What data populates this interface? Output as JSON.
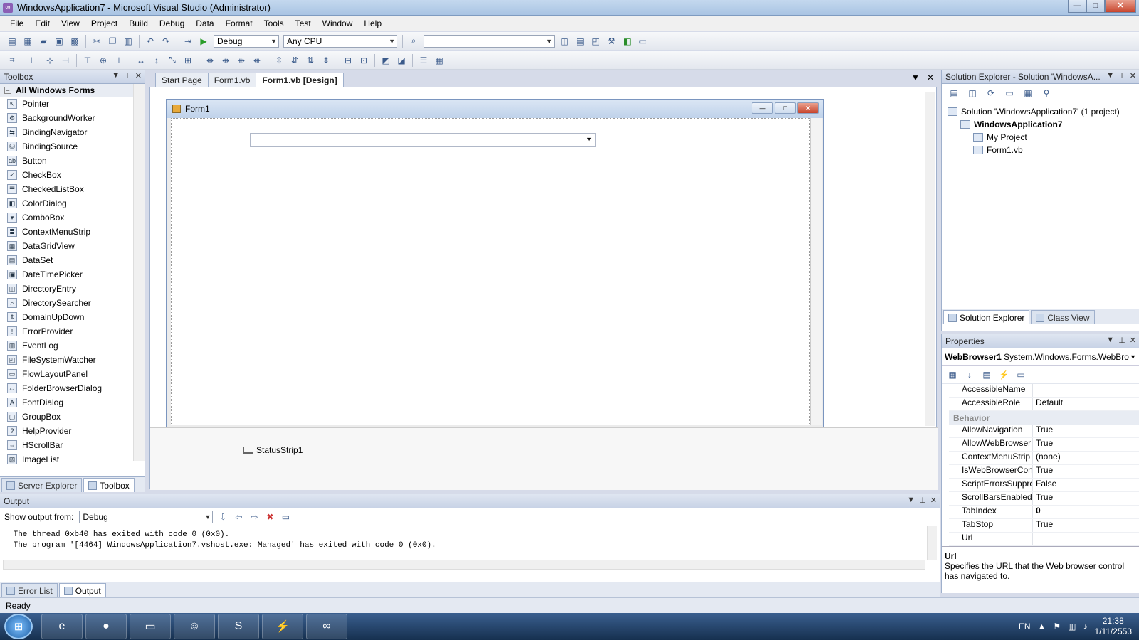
{
  "window": {
    "title": "WindowsApplication7 - Microsoft Visual Studio (Administrator)",
    "minimize": "—",
    "maximize": "□",
    "close": "✕"
  },
  "menu": [
    "File",
    "Edit",
    "View",
    "Project",
    "Build",
    "Debug",
    "Data",
    "Format",
    "Tools",
    "Test",
    "Window",
    "Help"
  ],
  "toolbar": {
    "config": "Debug",
    "platform": "Any CPU",
    "find": ""
  },
  "toolbox": {
    "title": "Toolbox",
    "group": "All Windows Forms",
    "items": [
      {
        "label": "Pointer",
        "icon": "pointer-icon",
        "glyph": "↖"
      },
      {
        "label": "BackgroundWorker",
        "icon": "background-worker-icon",
        "glyph": "⚙"
      },
      {
        "label": "BindingNavigator",
        "icon": "binding-navigator-icon",
        "glyph": "⇆"
      },
      {
        "label": "BindingSource",
        "icon": "binding-source-icon",
        "glyph": "⛁"
      },
      {
        "label": "Button",
        "icon": "button-icon",
        "glyph": "ab"
      },
      {
        "label": "CheckBox",
        "icon": "checkbox-icon",
        "glyph": "✓"
      },
      {
        "label": "CheckedListBox",
        "icon": "checked-listbox-icon",
        "glyph": "☰"
      },
      {
        "label": "ColorDialog",
        "icon": "color-dialog-icon",
        "glyph": "◧"
      },
      {
        "label": "ComboBox",
        "icon": "combobox-icon",
        "glyph": "▾"
      },
      {
        "label": "ContextMenuStrip",
        "icon": "context-menu-icon",
        "glyph": "≣"
      },
      {
        "label": "DataGridView",
        "icon": "datagrid-icon",
        "glyph": "▦"
      },
      {
        "label": "DataSet",
        "icon": "dataset-icon",
        "glyph": "▤"
      },
      {
        "label": "DateTimePicker",
        "icon": "datetimepicker-icon",
        "glyph": "▣"
      },
      {
        "label": "DirectoryEntry",
        "icon": "directory-entry-icon",
        "glyph": "◫"
      },
      {
        "label": "DirectorySearcher",
        "icon": "directory-searcher-icon",
        "glyph": "⌕"
      },
      {
        "label": "DomainUpDown",
        "icon": "domain-updown-icon",
        "glyph": "⇕"
      },
      {
        "label": "ErrorProvider",
        "icon": "error-provider-icon",
        "glyph": "!"
      },
      {
        "label": "EventLog",
        "icon": "eventlog-icon",
        "glyph": "▥"
      },
      {
        "label": "FileSystemWatcher",
        "icon": "filesystem-watcher-icon",
        "glyph": "◰"
      },
      {
        "label": "FlowLayoutPanel",
        "icon": "flowlayout-icon",
        "glyph": "▭"
      },
      {
        "label": "FolderBrowserDialog",
        "icon": "folder-browser-icon",
        "glyph": "▱"
      },
      {
        "label": "FontDialog",
        "icon": "font-dialog-icon",
        "glyph": "A"
      },
      {
        "label": "GroupBox",
        "icon": "groupbox-icon",
        "glyph": "▢"
      },
      {
        "label": "HelpProvider",
        "icon": "help-provider-icon",
        "glyph": "?"
      },
      {
        "label": "HScrollBar",
        "icon": "hscrollbar-icon",
        "glyph": "⇔"
      },
      {
        "label": "ImageList",
        "icon": "imagelist-icon",
        "glyph": "▧"
      }
    ],
    "tabs": [
      {
        "label": "Server Explorer"
      },
      {
        "label": "Toolbox"
      }
    ]
  },
  "doctabs": [
    {
      "label": "Start Page"
    },
    {
      "label": "Form1.vb"
    },
    {
      "label": "Form1.vb [Design]"
    }
  ],
  "designer": {
    "form_title": "Form1",
    "statusstrip": "StatusStrip1"
  },
  "solution": {
    "title": "Solution Explorer - Solution 'WindowsA...",
    "nodes": [
      {
        "label": "Solution 'WindowsApplication7' (1 project)",
        "indent": 0,
        "bold": false
      },
      {
        "label": "WindowsApplication7",
        "indent": 1,
        "bold": true
      },
      {
        "label": "My Project",
        "indent": 2,
        "bold": false
      },
      {
        "label": "Form1.vb",
        "indent": 2,
        "bold": false
      }
    ],
    "tabs": [
      {
        "label": "Solution Explorer"
      },
      {
        "label": "Class View"
      }
    ]
  },
  "properties": {
    "title": "Properties",
    "object": "WebBrowser1",
    "object_type": "System.Windows.Forms.WebBro",
    "rows": [
      {
        "name": "AccessibleName",
        "value": "",
        "cat": false
      },
      {
        "name": "AccessibleRole",
        "value": "Default",
        "cat": false
      },
      {
        "name": "Behavior",
        "value": "",
        "cat": true
      },
      {
        "name": "AllowNavigation",
        "value": "True",
        "cat": false
      },
      {
        "name": "AllowWebBrowserDro",
        "value": "True",
        "cat": false
      },
      {
        "name": "ContextMenuStrip",
        "value": "(none)",
        "cat": false
      },
      {
        "name": "IsWebBrowserContext",
        "value": "True",
        "cat": false
      },
      {
        "name": "ScriptErrorsSuppresse",
        "value": "False",
        "cat": false
      },
      {
        "name": "ScrollBarsEnabled",
        "value": "True",
        "cat": false
      },
      {
        "name": "TabIndex",
        "value": "0",
        "cat": false
      },
      {
        "name": "TabStop",
        "value": "True",
        "cat": false
      },
      {
        "name": "Url",
        "value": "",
        "cat": false
      }
    ],
    "desc_title": "Url",
    "desc_text": "Specifies the URL that the Web browser control has navigated to."
  },
  "output": {
    "title": "Output",
    "show_from_label": "Show output from:",
    "show_from_value": "Debug",
    "lines": " The thread 0xb40 has exited with code 0 (0x0).\n The program '[4464] WindowsApplication7.vshost.exe: Managed' has exited with code 0 (0x0).",
    "tabs": [
      {
        "label": "Error List"
      },
      {
        "label": "Output"
      }
    ]
  },
  "statusbar": {
    "text": "Ready"
  },
  "taskbar": {
    "lang": "EN",
    "time": "21:38",
    "date": "1/11/2553"
  }
}
